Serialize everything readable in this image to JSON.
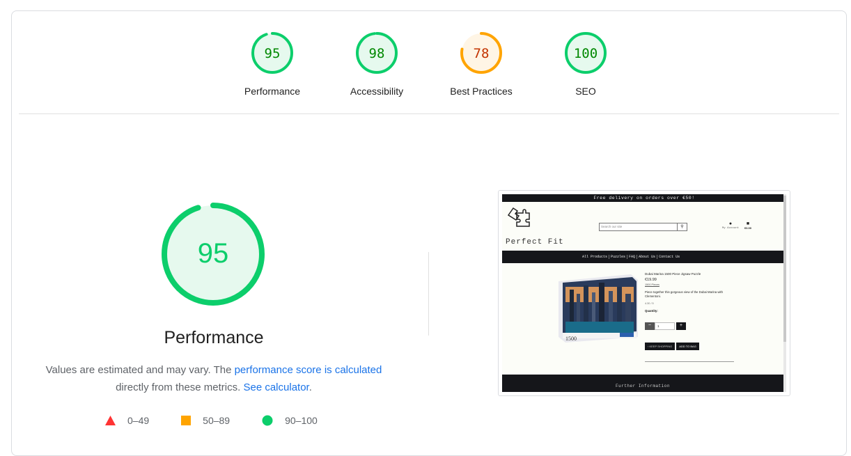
{
  "categories": [
    {
      "label": "Performance",
      "score": "95",
      "fraction": 0.95,
      "status": "pass"
    },
    {
      "label": "Accessibility",
      "score": "98",
      "fraction": 0.98,
      "status": "pass"
    },
    {
      "label": "Best Practices",
      "score": "78",
      "fraction": 0.78,
      "status": "average"
    },
    {
      "label": "SEO",
      "score": "100",
      "fraction": 1.0,
      "status": "pass"
    }
  ],
  "colors": {
    "pass": "#0cce6b",
    "pass_bg": "#e6f9ee",
    "pass_text": "#008800",
    "average": "#ffa400",
    "average_bg": "#fff5e5",
    "average_text": "#c33300",
    "fail": "#ff3333",
    "link": "#1a73e8"
  },
  "main": {
    "title": "Performance",
    "score": "95",
    "fraction": 0.95,
    "description_prefix": "Values are estimated and may vary. The ",
    "description_link1": "performance score is calculated",
    "description_mid": " directly from these metrics. ",
    "description_link2": "See calculator",
    "description_suffix": "."
  },
  "legend": [
    {
      "shape": "triangle-icon",
      "label": "0–49"
    },
    {
      "shape": "square-icon",
      "label": "50–89"
    },
    {
      "shape": "circle-icon",
      "label": "90–100"
    }
  ],
  "screenshot": {
    "topbar": "Free delivery on orders over €50!",
    "search_placeholder": "Search our site",
    "account_label": "My Account",
    "bag_label": "€0.00",
    "brand": "Perfect Fit",
    "nav": [
      "All Products",
      "Puzzles",
      "FAQ",
      "About Us",
      "Contact Us"
    ],
    "product_name": "Dubai Marina 1500 Piece Jigsaw Puzzle",
    "product_price": "€19.99",
    "product_category": "1500 Pieces",
    "product_blurb": "Piece together this gorgeous view of the Dubai Marina with Clementoni.",
    "product_rating": "4.30 / 5",
    "quantity_label": "Quantity:",
    "quantity_value": "1",
    "keep_shopping": "KEEP SHOPPING",
    "add_to_bag": "ADD TO BAG",
    "box_text": "1500",
    "footer": "Further Information"
  }
}
